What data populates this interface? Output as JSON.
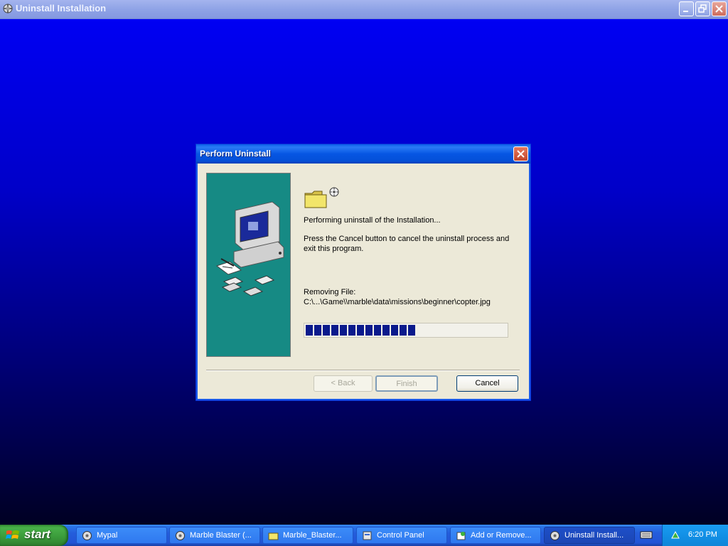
{
  "main_window": {
    "title": "Uninstall Installation"
  },
  "dialog": {
    "title": "Perform Uninstall",
    "status": "Performing uninstall of the Installation...",
    "instructions_line1": "Press the Cancel button to cancel the uninstall process and",
    "instructions_line2": "exit this program.",
    "removing_label": "Removing File:",
    "removing_path": "C:\\...\\Game\\\\marble\\data\\missions\\beginner\\copter.jpg",
    "progress_fraction": 0.58,
    "buttons": {
      "back": "< Back",
      "finish": "Finish",
      "cancel": "Cancel"
    }
  },
  "taskbar": {
    "start_label": "start",
    "tasks": [
      {
        "label": "Mypal",
        "icon": "app-icon"
      },
      {
        "label": "Marble Blaster (...",
        "icon": "app-icon"
      },
      {
        "label": "Marble_Blaster...",
        "icon": "folder-icon"
      },
      {
        "label": "Control Panel",
        "icon": "control-panel-icon"
      },
      {
        "label": "Add or Remove...",
        "icon": "add-remove-icon"
      },
      {
        "label": "Uninstall Install...",
        "icon": "installer-icon"
      }
    ],
    "clock": "6:20 PM"
  },
  "colors": {
    "desktop_top": "#0000f8",
    "dialog_bg": "#ece9d8",
    "progress_block": "#0a1a8c",
    "side_panel": "#168a84"
  }
}
